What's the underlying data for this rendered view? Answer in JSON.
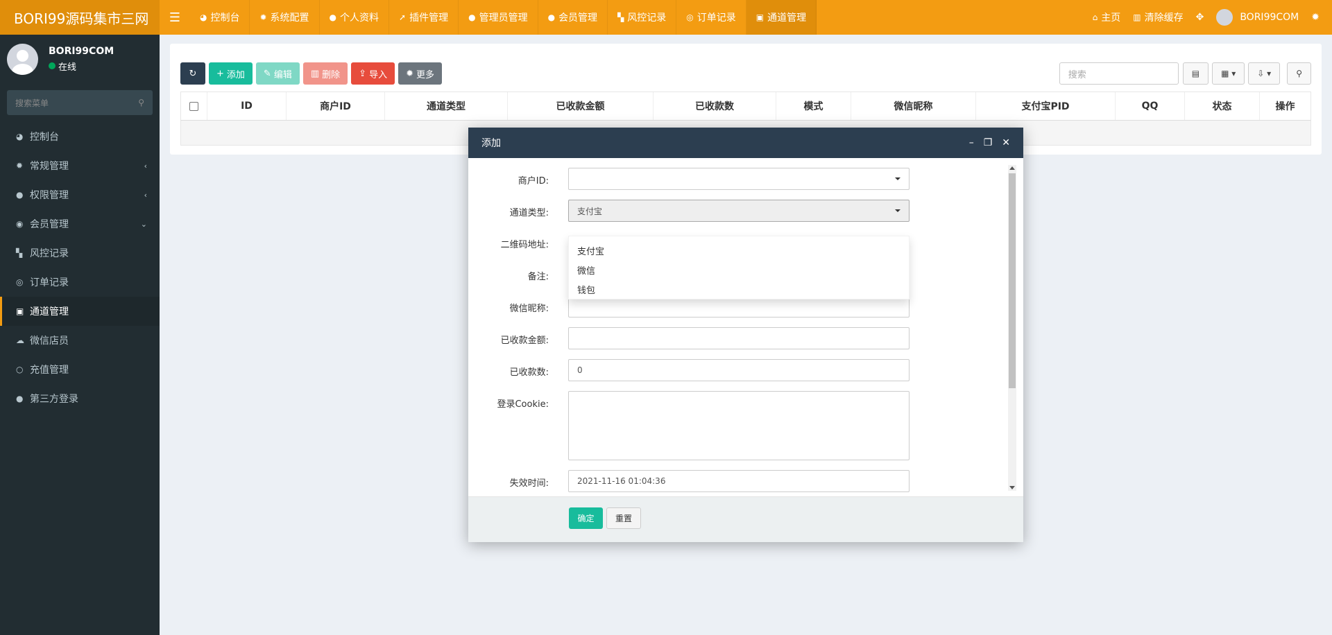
{
  "header": {
    "brand": "BORI99源码集市三网",
    "menu_icon": "bars-icon",
    "nav": [
      {
        "label": "控制台",
        "icon": "dashboard-icon"
      },
      {
        "label": "系统配置",
        "icon": "gear-icon"
      },
      {
        "label": "个人资料",
        "icon": "user-icon"
      },
      {
        "label": "插件管理",
        "icon": "rocket-icon"
      },
      {
        "label": "管理员管理",
        "icon": "user-icon"
      },
      {
        "label": "会员管理",
        "icon": "user-icon"
      },
      {
        "label": "风控记录",
        "icon": "map-icon"
      },
      {
        "label": "订单记录",
        "icon": "chrome-icon"
      },
      {
        "label": "通道管理",
        "icon": "channel-icon"
      }
    ],
    "right": {
      "home": "主页",
      "clear_cache": "清除缓存",
      "username": "BORI99COM"
    }
  },
  "sidebar": {
    "username": "BORI99COM",
    "status": "在线",
    "search_placeholder": "搜索菜单",
    "items": [
      {
        "label": "控制台",
        "icon": "dashboard-icon",
        "arrow": ""
      },
      {
        "label": "常规管理",
        "icon": "cogs-icon",
        "arrow": "‹"
      },
      {
        "label": "权限管理",
        "icon": "group-icon",
        "arrow": "‹"
      },
      {
        "label": "会员管理",
        "icon": "user-circle-icon",
        "arrow": "⌄"
      },
      {
        "label": "风控记录",
        "icon": "map-icon",
        "arrow": ""
      },
      {
        "label": "订单记录",
        "icon": "chrome-icon",
        "arrow": ""
      },
      {
        "label": "通道管理",
        "icon": "channel-icon",
        "arrow": ""
      },
      {
        "label": "微信店员",
        "icon": "wechat-icon",
        "arrow": ""
      },
      {
        "label": "充值管理",
        "icon": "circle-icon",
        "arrow": ""
      },
      {
        "label": "第三方登录",
        "icon": "group-icon",
        "arrow": ""
      }
    ]
  },
  "toolbar": {
    "add": "添加",
    "edit": "编辑",
    "delete": "删除",
    "import": "导入",
    "more": "更多",
    "search_placeholder": "搜索"
  },
  "table": {
    "columns": [
      "ID",
      "商户ID",
      "通道类型",
      "已收款金额",
      "已收款数",
      "模式",
      "微信昵称",
      "支付宝PID",
      "QQ",
      "状态",
      "操作"
    ]
  },
  "modal": {
    "title": "添加",
    "fields": {
      "merchant_id": {
        "label": "商户ID:",
        "value": ""
      },
      "channel_type": {
        "label": "通道类型:",
        "value": "支付宝"
      },
      "qr_url": {
        "label": "二维码地址:"
      },
      "note": {
        "label": "备注:"
      },
      "wechat_nick": {
        "label": "微信昵称:",
        "value": ""
      },
      "received_amount": {
        "label": "已收款金额:",
        "value": ""
      },
      "received_count": {
        "label": "已收款数:",
        "value": "0"
      },
      "login_cookie": {
        "label": "登录Cookie:",
        "value": ""
      },
      "expire_time": {
        "label": "失效时间:",
        "value": "2021-11-16 01:04:36"
      }
    },
    "dropdown_options": [
      "支付宝",
      "微信",
      "钱包"
    ],
    "ok": "确定",
    "reset": "重置"
  }
}
